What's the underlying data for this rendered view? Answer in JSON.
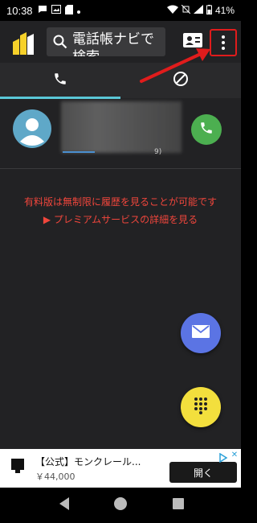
{
  "status_bar": {
    "time": "10:38",
    "battery": "41%",
    "icons": [
      "chat-bubble-icon",
      "image-icon",
      "sd-card-icon",
      "dot-icon",
      "wifi-icon",
      "mute-icon",
      "signal-icon",
      "battery-icon"
    ]
  },
  "toolbar": {
    "search_placeholder": "電話帳ナビで検索",
    "icons": [
      "app-logo-icon",
      "search-icon",
      "contact-card-icon",
      "more-options-icon"
    ]
  },
  "tabs": [
    {
      "name": "calls",
      "icon": "phone-icon",
      "selected": true
    },
    {
      "name": "blocked",
      "icon": "block-icon",
      "selected": false
    }
  ],
  "call_list": [
    {
      "meta": "9)",
      "icon": "person-avatar-icon",
      "action_icon": "phone-call-icon"
    }
  ],
  "promo": {
    "line1": "有料版は無制限に履歴を見ることが可能です",
    "line2": "▶ プレミアムサービスの詳細を見る"
  },
  "fabs": [
    {
      "name": "message",
      "icon": "mail-icon",
      "color": "#5b74e4"
    },
    {
      "name": "dialpad",
      "icon": "dialpad-icon",
      "color": "#f3df3d"
    }
  ],
  "ad": {
    "title": "【公式】モンクレール...",
    "price": "￥44,000",
    "button": "開く"
  },
  "colors": {
    "accent": "#5ac8d8",
    "promo_red": "#f0463c",
    "annotation_red": "#e01c1c",
    "call_green": "#4caf50"
  }
}
